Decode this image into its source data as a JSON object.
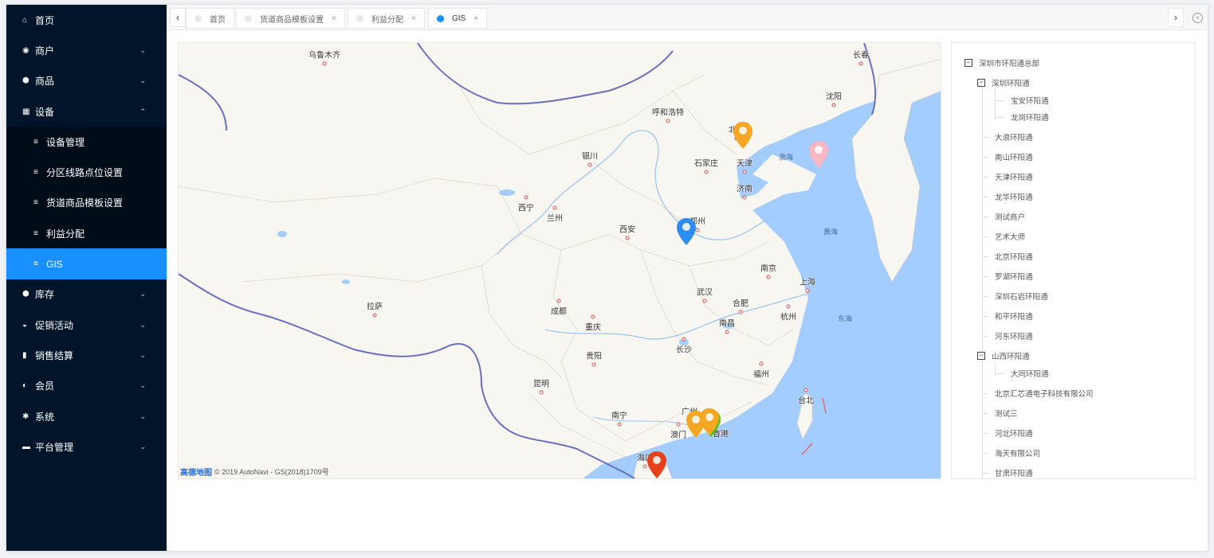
{
  "sidebar": {
    "items": [
      {
        "icon": "home-icon",
        "glyph": "⌂",
        "label": "首页",
        "has_arrow": false
      },
      {
        "icon": "user-circle-icon",
        "glyph": "◉",
        "label": "商户",
        "has_arrow": true,
        "arrow": "⌄"
      },
      {
        "icon": "cube-icon",
        "glyph": "⬢",
        "label": "商品",
        "has_arrow": true,
        "arrow": "⌄"
      },
      {
        "icon": "device-icon",
        "glyph": "▦",
        "label": "设备",
        "has_arrow": true,
        "arrow": "⌃",
        "expanded": true
      }
    ],
    "sub_items": [
      {
        "label": "设备管理"
      },
      {
        "label": "分区线路点位设置"
      },
      {
        "label": "货道商品模板设置"
      },
      {
        "label": "利益分配"
      },
      {
        "label": "GIS",
        "active": true
      }
    ],
    "items_after": [
      {
        "icon": "inventory-icon",
        "glyph": "⬢",
        "label": "库存"
      },
      {
        "icon": "promotion-icon",
        "glyph": "◒",
        "label": "促销活动"
      },
      {
        "icon": "bag-icon",
        "glyph": "▮",
        "label": "销售结算"
      },
      {
        "icon": "member-icon",
        "glyph": "◐",
        "label": "会员"
      },
      {
        "icon": "gear-icon",
        "glyph": "✱",
        "label": "系统"
      },
      {
        "icon": "platform-icon",
        "glyph": "▬",
        "label": "平台管理"
      }
    ],
    "sub_glyph": "≡",
    "arrow_glyph": "⌄"
  },
  "tabs": {
    "prev_glyph": "‹",
    "next_glyph": "›",
    "close_all_glyph": "×",
    "close_glyph": "×",
    "items": [
      {
        "label": "首页",
        "closable": false
      },
      {
        "label": "货道商品模板设置",
        "closable": true
      },
      {
        "label": "利益分配",
        "closable": true
      },
      {
        "label": "GIS",
        "closable": true,
        "active": true
      }
    ]
  },
  "map": {
    "cities": [
      "乌鲁木齐",
      "长春",
      "呼和浩特",
      "沈阳",
      "北京",
      "银川",
      "石家庄",
      "天津",
      "济南",
      "西宁",
      "兰州",
      "西安",
      "郑州",
      "南京",
      "上海",
      "武汉",
      "合肥",
      "成都",
      "拉萨",
      "重庆",
      "杭州",
      "南昌",
      "长沙",
      "贵阳",
      "福州",
      "昆明",
      "台北",
      "南宁",
      "广州",
      "澳门",
      "香港",
      "海口"
    ],
    "seas": [
      "渤海",
      "黄海",
      "东海"
    ],
    "attribution_logo": "高德地图",
    "attribution_text": "© 2019 AutoNavi - GS(2018)1709号",
    "markers": [
      {
        "name": "beijing-marker",
        "color": "#f5a623"
      },
      {
        "name": "dalian-marker",
        "color": "#f7b7c3"
      },
      {
        "name": "zhengzhou-marker",
        "color": "#2d8cf0"
      },
      {
        "name": "guangzhou-marker",
        "color": "#f5a623"
      },
      {
        "name": "shenzhen-marker-green",
        "color": "#52c41a"
      },
      {
        "name": "shenzhen-marker",
        "color": "#f5a623"
      },
      {
        "name": "haikou-marker",
        "color": "#e8401c"
      }
    ]
  },
  "tree": {
    "collapse_glyph": "−",
    "nodes": [
      {
        "label": "深圳市环阳通总部",
        "level": 0,
        "toggle": true
      },
      {
        "label": "深圳环阳通",
        "level": 1,
        "toggle": true
      },
      {
        "label": "宝安环阳通",
        "level": 2
      },
      {
        "label": "龙岗环阳通",
        "level": 2
      },
      {
        "label": "大浪环阳通",
        "level": 1
      },
      {
        "label": "南山环阳通",
        "level": 1
      },
      {
        "label": "天津环阳通",
        "level": 1
      },
      {
        "label": "龙华环阳通",
        "level": 1
      },
      {
        "label": "测试商户",
        "level": 1
      },
      {
        "label": "艺术大师",
        "level": 1
      },
      {
        "label": "北京环阳通",
        "level": 1
      },
      {
        "label": "罗湖环阳通",
        "level": 1
      },
      {
        "label": "深圳石岩环阳通",
        "level": 1
      },
      {
        "label": "和平环阳通",
        "level": 1
      },
      {
        "label": "河东环阳通",
        "level": 1
      },
      {
        "label": "山西环阳通",
        "level": 1,
        "toggle": true
      },
      {
        "label": "大同环阳通",
        "level": 2
      },
      {
        "label": "北京汇芯通电子科技有限公司",
        "level": 1
      },
      {
        "label": "测试三",
        "level": 1
      },
      {
        "label": "河北环阳通",
        "level": 1
      },
      {
        "label": "海天有限公司",
        "level": 1
      },
      {
        "label": "甘肃环阳通",
        "level": 1
      }
    ]
  },
  "colors": {
    "sidebar_bg": "#001529",
    "submenu_bg": "#000c17",
    "accent": "#1890ff",
    "land": "#f8f6f0",
    "water": "#a3ccff",
    "border": "#6a6fc2"
  }
}
